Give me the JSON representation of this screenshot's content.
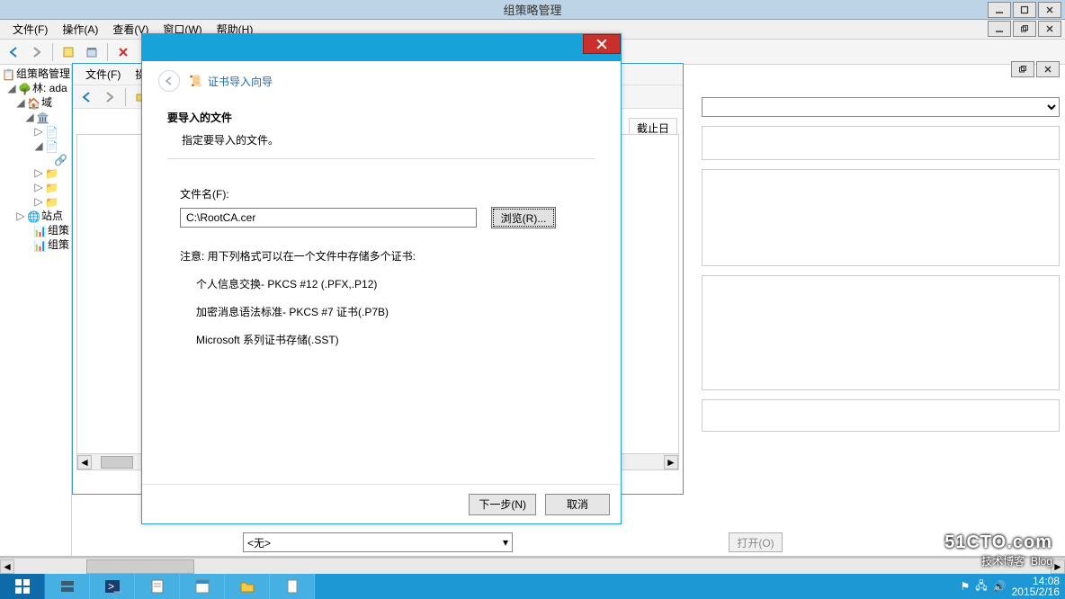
{
  "app": {
    "title": "组策略管理"
  },
  "menus": {
    "file": "文件(F)",
    "action": "操作(A)",
    "view": "查看(V)",
    "window": "窗口(W)",
    "help": "帮助(H)"
  },
  "tree": {
    "root": "组策略管理",
    "l1": "林: ada",
    "l2": "域",
    "l3": "站点",
    "l4": "组策",
    "l5": "组策"
  },
  "win2": {
    "file": "文件(F)",
    "op": "操",
    "deadline": "截止日"
  },
  "wizard": {
    "title": "证书导入向导",
    "section_title": "要导入的文件",
    "section_sub": "指定要导入的文件。",
    "file_label": "文件名(F):",
    "file_value": "C:\\RootCA.cer",
    "browse": "浏览(R)...",
    "note": "注意: 用下列格式可以在一个文件中存储多个证书:",
    "fmt1": "个人信息交换- PKCS #12 (.PFX,.P12)",
    "fmt2": "加密消息语法标准- PKCS #7 证书(.P7B)",
    "fmt3": "Microsoft 系列证书存储(.SST)",
    "next": "下一步(N)",
    "cancel": "取消"
  },
  "lower": {
    "combo_value": "<无>",
    "open": "打开(O)"
  },
  "tray": {
    "time": "14:08",
    "date": "2015/2/16"
  },
  "watermark": {
    "big": "51CTO.com",
    "sub1": "技术博客",
    "sub2": "Blog"
  }
}
